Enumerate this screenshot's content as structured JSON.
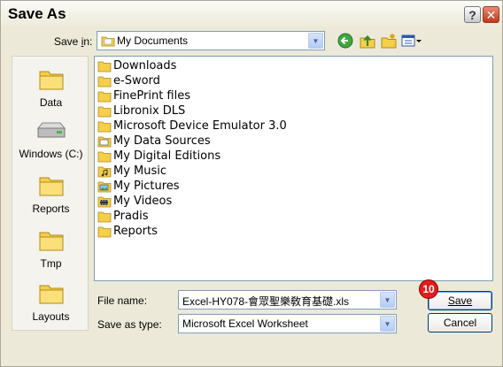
{
  "dialog": {
    "title": "Save As",
    "help_label": "?",
    "close_label": "✕"
  },
  "savein": {
    "label": "Save in:",
    "value": "My Documents"
  },
  "toolbar": {
    "icons": [
      "back-icon",
      "up-folder-icon",
      "new-folder-icon",
      "views-menu-icon"
    ]
  },
  "places": {
    "items": [
      {
        "label": "Data",
        "icon": "folder-icon"
      },
      {
        "label": "Windows (C:)",
        "icon": "drive-icon"
      },
      {
        "label": "Reports",
        "icon": "folder-icon"
      },
      {
        "label": "Tmp",
        "icon": "folder-icon"
      },
      {
        "label": "Layouts",
        "icon": "folder-icon"
      }
    ]
  },
  "files": {
    "items": [
      {
        "label": "Downloads",
        "icon": "folder-icon"
      },
      {
        "label": "e-Sword",
        "icon": "folder-icon"
      },
      {
        "label": "FinePrint files",
        "icon": "folder-icon"
      },
      {
        "label": "Libronix DLS",
        "icon": "folder-icon"
      },
      {
        "label": "Microsoft Device Emulator 3.0",
        "icon": "folder-icon"
      },
      {
        "label": "My Data Sources",
        "icon": "special-folder-icon"
      },
      {
        "label": "My Digital Editions",
        "icon": "folder-icon"
      },
      {
        "label": "My Music",
        "icon": "music-folder-icon"
      },
      {
        "label": "My Pictures",
        "icon": "pictures-folder-icon"
      },
      {
        "label": "My Videos",
        "icon": "videos-folder-icon"
      },
      {
        "label": "Pradis",
        "icon": "folder-icon"
      },
      {
        "label": "Reports",
        "icon": "folder-icon"
      }
    ]
  },
  "form": {
    "filename_label": "File name:",
    "filename_value": "Excel-HY078-會眾聖樂敎育基礎.xls",
    "filetype_label": "Save as type:",
    "filetype_value": "Microsoft Excel Worksheet",
    "save_label": "Save",
    "cancel_label": "Cancel",
    "step_badge": "10"
  },
  "colors": {
    "dialog_bg": "#ece9d8",
    "close_red": "#c2361a",
    "badge_red": "#e41c1c",
    "folder_yellow": "#f5cf4a"
  }
}
